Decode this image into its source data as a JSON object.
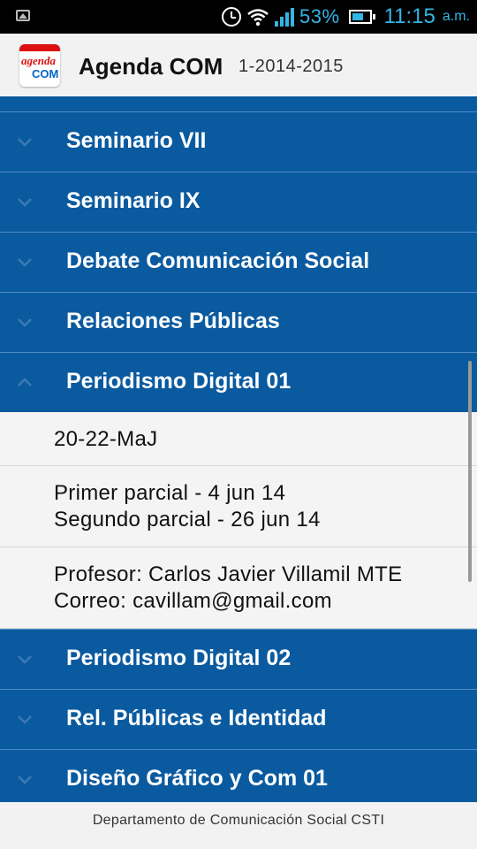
{
  "status_bar": {
    "battery_percent": "53%",
    "time": "11:15",
    "ampm": "a.m.",
    "icons": [
      "image-icon",
      "alarm-icon",
      "wifi-icon",
      "signal-icon",
      "battery-icon"
    ],
    "accent_color": "#33b5e5"
  },
  "app_bar": {
    "logo_text_top": "agenda",
    "logo_text_bottom": "COM",
    "title": "Agenda COM",
    "subtitle": "1-2014-2015"
  },
  "colors": {
    "header_bg": "#0a5aa0",
    "list_bg": "#f4f4f4"
  },
  "list": {
    "headers_before": [
      {
        "label": "Seminario VII"
      },
      {
        "label": "Seminario IX"
      },
      {
        "label": "Debate Comunicación Social"
      },
      {
        "label": "Relaciones Públicas"
      }
    ],
    "expanded": {
      "label": "Periodismo Digital 01",
      "children": [
        {
          "lines": [
            "20-22-MaJ"
          ]
        },
        {
          "lines": [
            "Primer parcial - 4 jun 14",
            "Segundo parcial - 26 jun 14"
          ]
        },
        {
          "lines": [
            "Profesor: Carlos Javier Villamil MTE",
            "Correo: cavillam@gmail.com"
          ]
        }
      ]
    },
    "headers_after": [
      {
        "label": "Periodismo Digital 02"
      },
      {
        "label": "Rel. Públicas e Identidad"
      },
      {
        "label": "Diseño Gráfico y Com 01"
      }
    ]
  },
  "footer": {
    "text": "Departamento de Comunicación Social CSTI"
  }
}
